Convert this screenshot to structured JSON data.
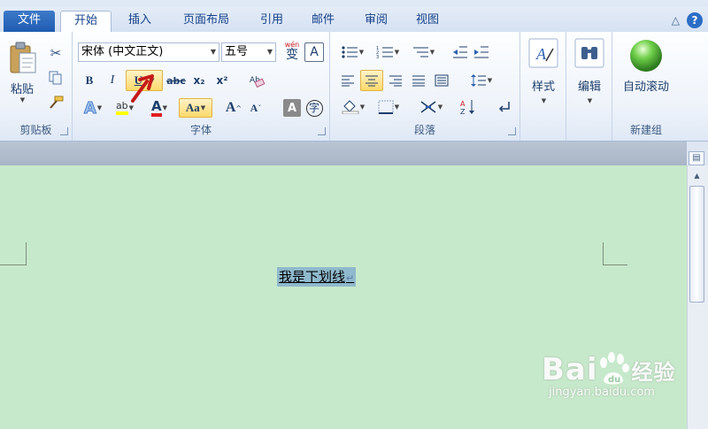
{
  "tabs": [
    {
      "label": "文件"
    },
    {
      "label": "开始"
    },
    {
      "label": "插入"
    },
    {
      "label": "页面布局"
    },
    {
      "label": "引用"
    },
    {
      "label": "邮件"
    },
    {
      "label": "审阅"
    },
    {
      "label": "视图"
    }
  ],
  "help": {
    "label": "?"
  },
  "groups": {
    "clipboard": {
      "label": "剪贴板",
      "paste_label": "粘贴"
    },
    "font": {
      "label": "字体",
      "font_name": "宋体 (中文正文)",
      "font_size": "五号",
      "bold": "B",
      "italic": "I",
      "underline": "U",
      "strike": "abc",
      "subscript": "x₂",
      "superscript": "x²",
      "change_case": "Aa",
      "grow": "A",
      "shrink": "A",
      "char_shading": "A",
      "enclose": "字",
      "phonetic": "wén",
      "highlight": "ab",
      "font_color": "A",
      "effects": "A",
      "char_border": "A"
    },
    "paragraph": {
      "label": "段落"
    },
    "styles": {
      "label": "样式"
    },
    "editing": {
      "label": "编辑"
    },
    "newgroup": {
      "label": "新建组",
      "auto_scroll": "自动滚动"
    }
  },
  "document": {
    "selected_text": "我是下划线",
    "para_mark": "↵"
  },
  "watermark": {
    "brand": "Bai",
    "brand2": "经验",
    "url": "jingyan.baidu.com"
  },
  "colors": {
    "accent": "#2b579a",
    "doc_bg": "#c7e9cb",
    "selection": "#8fb9cc",
    "highlight_btn": "#ffd96b"
  }
}
